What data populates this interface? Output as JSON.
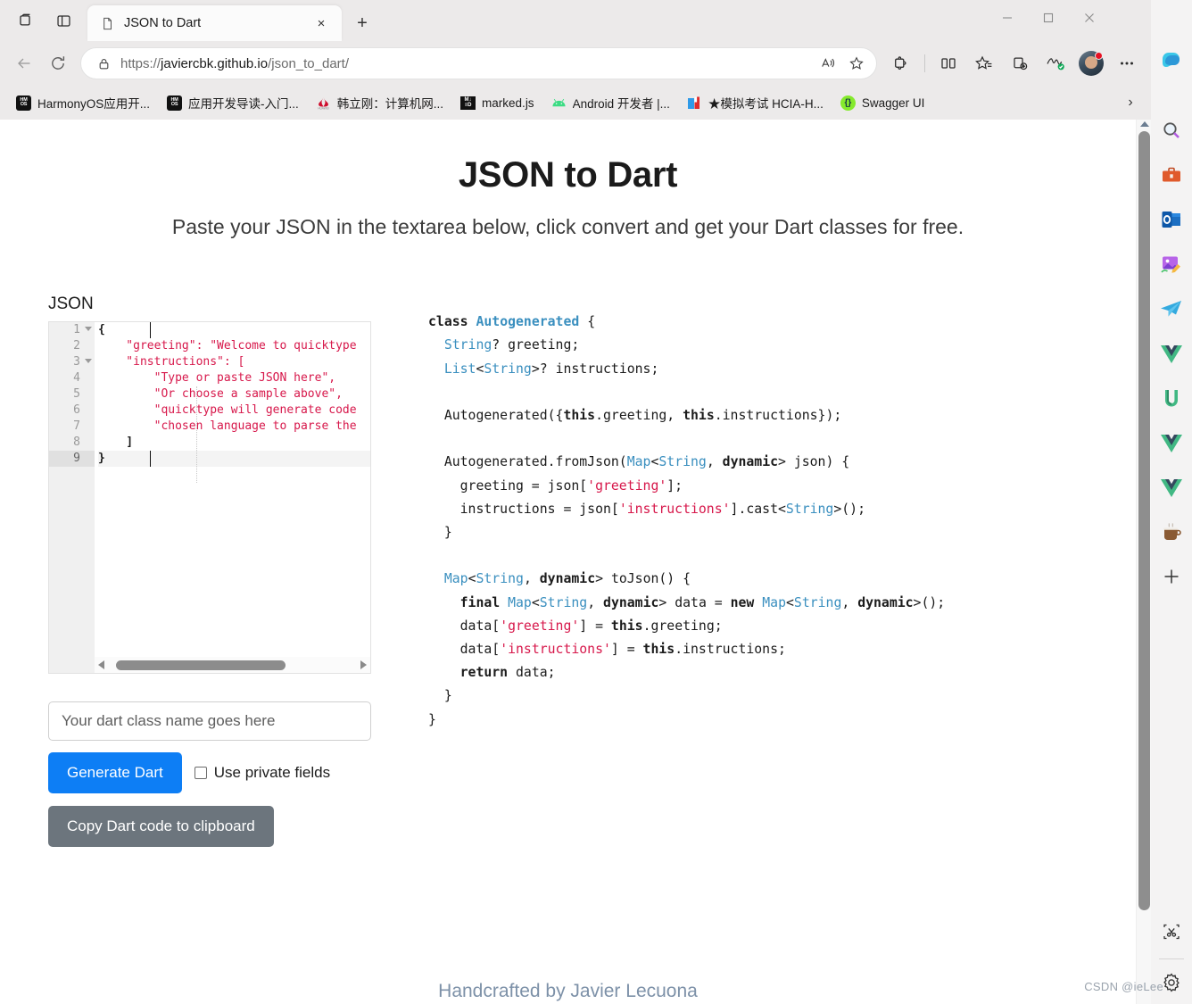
{
  "browser": {
    "tab": {
      "title": "JSON to Dart",
      "favicon": "document-icon",
      "close": "×"
    },
    "new_tab_label": "+",
    "window_controls": {
      "minimize": "—",
      "maximize": "☐",
      "close": "✕"
    },
    "address": {
      "url_scheme": "https://",
      "url_host": "javiercbk.github.io",
      "url_path": "/json_to_dart/",
      "lock_icon": "lock-icon",
      "read_aloud_icon": "read-aloud-icon",
      "favorite_icon": "star-icon"
    },
    "toolbar_icons": [
      "extensions-icon",
      "split-screen-icon",
      "favorites-icon",
      "collections-icon",
      "browser-essentials-icon",
      "profile-avatar",
      "settings-more-icon",
      "copilot-icon"
    ],
    "bookmarks": [
      {
        "label": "HarmonyOS应用开...",
        "icon": "hmos-icon"
      },
      {
        "label": "应用开发导读-入门...",
        "icon": "hmos-icon"
      },
      {
        "label": "韩立刚：计算机网...",
        "icon": "huawei-icon"
      },
      {
        "label": "marked.js",
        "icon": "marked-icon"
      },
      {
        "label": "Android 开发者 |...",
        "icon": "android-icon"
      },
      {
        "label": "★模拟考试 HCIA-H...",
        "icon": "book-icon"
      },
      {
        "label": "Swagger UI",
        "icon": "swagger-icon"
      }
    ],
    "bookmarks_overflow": "›"
  },
  "page": {
    "title": "JSON to Dart",
    "subtitle": "Paste your JSON in the textarea below, click convert and get your Dart classes for free.",
    "json_label": "JSON",
    "footer": "Handcrafted by Javier Lecuona"
  },
  "editor": {
    "line_numbers": [
      "1",
      "2",
      "3",
      "4",
      "5",
      "6",
      "7",
      "8",
      "9"
    ],
    "active_line": 9,
    "folds_at_lines": [
      1,
      3
    ],
    "lines": [
      "{",
      "    \"greeting\": \"Welcome to quicktype",
      "    \"instructions\": [",
      "        \"Type or paste JSON here\",",
      "        \"Or choose a sample above\",",
      "        \"quicktype will generate code",
      "        \"chosen language to parse the",
      "    ]",
      "}"
    ],
    "scroll_left_arrow": "◀",
    "scroll_right_arrow": "▶"
  },
  "form": {
    "classname_placeholder": "Your dart class name goes here",
    "classname_value": "",
    "generate_label": "Generate Dart",
    "private_fields_label": "Use private fields",
    "private_fields_checked": false,
    "copy_label": "Copy Dart code to clipboard"
  },
  "dart_output": {
    "lines": [
      "class Autogenerated {",
      "  String? greeting;",
      "  List<String>? instructions;",
      "",
      "  Autogenerated({this.greeting, this.instructions});",
      "",
      "  Autogenerated.fromJson(Map<String, dynamic> json) {",
      "    greeting = json['greeting'];",
      "    instructions = json['instructions'].cast<String>();",
      "  }",
      "",
      "  Map<String, dynamic> toJson() {",
      "    final Map<String, dynamic> data = new Map<String, dynamic>();",
      "    data['greeting'] = this.greeting;",
      "    data['instructions'] = this.instructions;",
      "    return data;",
      "  }",
      "}"
    ]
  },
  "edge_sidebar": {
    "items": [
      "search-icon",
      "tools-briefcase-icon",
      "outlook-icon",
      "image-editor-icon",
      "telegram-icon",
      "vue-icon",
      "u-icon",
      "vue-icon",
      "vue-icon",
      "coffee-cup-icon"
    ],
    "add_label": "+",
    "bottom_items": [
      "screenshot-scissors-icon",
      "settings-gear-icon"
    ]
  },
  "colors": {
    "accent_blue": "#0d7ef5",
    "gray_button": "#6c757d",
    "string_red": "#d7184b",
    "type_blue": "#3a8fbf",
    "footer_blue": "#7d91a8"
  },
  "watermark": "CSDN @ieLee"
}
